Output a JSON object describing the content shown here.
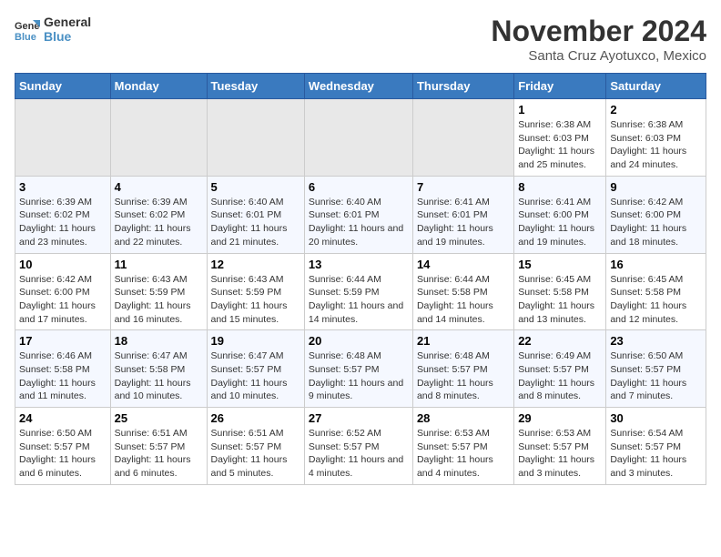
{
  "logo": {
    "line1": "General",
    "line2": "Blue"
  },
  "title": "November 2024",
  "subtitle": "Santa Cruz Ayotuxco, Mexico",
  "days_of_week": [
    "Sunday",
    "Monday",
    "Tuesday",
    "Wednesday",
    "Thursday",
    "Friday",
    "Saturday"
  ],
  "weeks": [
    [
      {
        "day": "",
        "info": ""
      },
      {
        "day": "",
        "info": ""
      },
      {
        "day": "",
        "info": ""
      },
      {
        "day": "",
        "info": ""
      },
      {
        "day": "",
        "info": ""
      },
      {
        "day": "1",
        "info": "Sunrise: 6:38 AM\nSunset: 6:03 PM\nDaylight: 11 hours and 25 minutes."
      },
      {
        "day": "2",
        "info": "Sunrise: 6:38 AM\nSunset: 6:03 PM\nDaylight: 11 hours and 24 minutes."
      }
    ],
    [
      {
        "day": "3",
        "info": "Sunrise: 6:39 AM\nSunset: 6:02 PM\nDaylight: 11 hours and 23 minutes."
      },
      {
        "day": "4",
        "info": "Sunrise: 6:39 AM\nSunset: 6:02 PM\nDaylight: 11 hours and 22 minutes."
      },
      {
        "day": "5",
        "info": "Sunrise: 6:40 AM\nSunset: 6:01 PM\nDaylight: 11 hours and 21 minutes."
      },
      {
        "day": "6",
        "info": "Sunrise: 6:40 AM\nSunset: 6:01 PM\nDaylight: 11 hours and 20 minutes."
      },
      {
        "day": "7",
        "info": "Sunrise: 6:41 AM\nSunset: 6:01 PM\nDaylight: 11 hours and 19 minutes."
      },
      {
        "day": "8",
        "info": "Sunrise: 6:41 AM\nSunset: 6:00 PM\nDaylight: 11 hours and 19 minutes."
      },
      {
        "day": "9",
        "info": "Sunrise: 6:42 AM\nSunset: 6:00 PM\nDaylight: 11 hours and 18 minutes."
      }
    ],
    [
      {
        "day": "10",
        "info": "Sunrise: 6:42 AM\nSunset: 6:00 PM\nDaylight: 11 hours and 17 minutes."
      },
      {
        "day": "11",
        "info": "Sunrise: 6:43 AM\nSunset: 5:59 PM\nDaylight: 11 hours and 16 minutes."
      },
      {
        "day": "12",
        "info": "Sunrise: 6:43 AM\nSunset: 5:59 PM\nDaylight: 11 hours and 15 minutes."
      },
      {
        "day": "13",
        "info": "Sunrise: 6:44 AM\nSunset: 5:59 PM\nDaylight: 11 hours and 14 minutes."
      },
      {
        "day": "14",
        "info": "Sunrise: 6:44 AM\nSunset: 5:58 PM\nDaylight: 11 hours and 14 minutes."
      },
      {
        "day": "15",
        "info": "Sunrise: 6:45 AM\nSunset: 5:58 PM\nDaylight: 11 hours and 13 minutes."
      },
      {
        "day": "16",
        "info": "Sunrise: 6:45 AM\nSunset: 5:58 PM\nDaylight: 11 hours and 12 minutes."
      }
    ],
    [
      {
        "day": "17",
        "info": "Sunrise: 6:46 AM\nSunset: 5:58 PM\nDaylight: 11 hours and 11 minutes."
      },
      {
        "day": "18",
        "info": "Sunrise: 6:47 AM\nSunset: 5:58 PM\nDaylight: 11 hours and 10 minutes."
      },
      {
        "day": "19",
        "info": "Sunrise: 6:47 AM\nSunset: 5:57 PM\nDaylight: 11 hours and 10 minutes."
      },
      {
        "day": "20",
        "info": "Sunrise: 6:48 AM\nSunset: 5:57 PM\nDaylight: 11 hours and 9 minutes."
      },
      {
        "day": "21",
        "info": "Sunrise: 6:48 AM\nSunset: 5:57 PM\nDaylight: 11 hours and 8 minutes."
      },
      {
        "day": "22",
        "info": "Sunrise: 6:49 AM\nSunset: 5:57 PM\nDaylight: 11 hours and 8 minutes."
      },
      {
        "day": "23",
        "info": "Sunrise: 6:50 AM\nSunset: 5:57 PM\nDaylight: 11 hours and 7 minutes."
      }
    ],
    [
      {
        "day": "24",
        "info": "Sunrise: 6:50 AM\nSunset: 5:57 PM\nDaylight: 11 hours and 6 minutes."
      },
      {
        "day": "25",
        "info": "Sunrise: 6:51 AM\nSunset: 5:57 PM\nDaylight: 11 hours and 6 minutes."
      },
      {
        "day": "26",
        "info": "Sunrise: 6:51 AM\nSunset: 5:57 PM\nDaylight: 11 hours and 5 minutes."
      },
      {
        "day": "27",
        "info": "Sunrise: 6:52 AM\nSunset: 5:57 PM\nDaylight: 11 hours and 4 minutes."
      },
      {
        "day": "28",
        "info": "Sunrise: 6:53 AM\nSunset: 5:57 PM\nDaylight: 11 hours and 4 minutes."
      },
      {
        "day": "29",
        "info": "Sunrise: 6:53 AM\nSunset: 5:57 PM\nDaylight: 11 hours and 3 minutes."
      },
      {
        "day": "30",
        "info": "Sunrise: 6:54 AM\nSunset: 5:57 PM\nDaylight: 11 hours and 3 minutes."
      }
    ]
  ]
}
